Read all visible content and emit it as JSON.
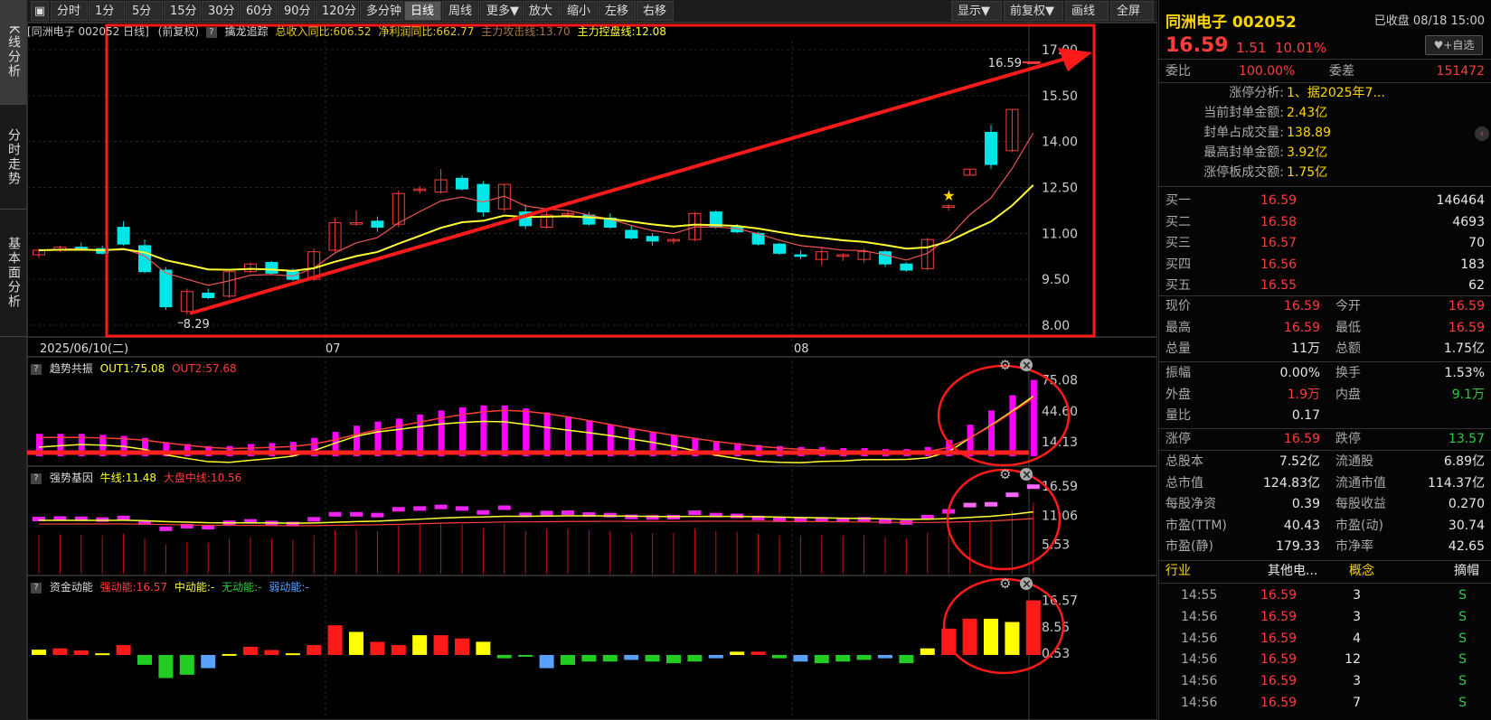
{
  "side_tabs": [
    "K线分析",
    "分时走势",
    "基本面分析"
  ],
  "toolbar": {
    "left": [
      "分时",
      "1分",
      "5分",
      "15分",
      "30分",
      "60分",
      "90分",
      "120分",
      "多分钟",
      "日线",
      "周线",
      "更多▼",
      "放大",
      "缩小",
      "左移",
      "右移"
    ],
    "right": [
      "显示▼",
      "前复权▼",
      "画线",
      "全屏"
    ],
    "active": "日线"
  },
  "main_panel": {
    "title": "[同洲电子 002052 日线]",
    "adjust": "(前复权)",
    "indicator_name": "擒龙追踪",
    "metrics": [
      {
        "text": "总收入同比:606.52",
        "color": "#e6c82e"
      },
      {
        "text": "净利润同比:662.77",
        "color": "#e6c82e"
      },
      {
        "text": "主力攻击线:13.70",
        "color": "#ee5555"
      },
      {
        "text": "主力控盘线:12.08",
        "color": "#ffff33"
      }
    ],
    "y_ticks": [
      "17.00",
      "15.50",
      "14.00",
      "12.50",
      "11.00",
      "9.50",
      "8.00"
    ],
    "last_price_label": "16.59",
    "low_label": "8.29",
    "date_labels": [
      "2025/06/10(二)",
      "07",
      "08"
    ]
  },
  "panel2": {
    "name": "趋势共振",
    "metrics": [
      {
        "text": "OUT1:75.08",
        "color": "#ffff33"
      },
      {
        "text": "OUT2:57.68",
        "color": "#ff3c3c"
      }
    ],
    "y_ticks": [
      "75.08",
      "44.60",
      "14.13"
    ]
  },
  "panel3": {
    "name": "强势基因",
    "metrics": [
      {
        "text": "牛线:11.48",
        "color": "#ffff33"
      },
      {
        "text": "大盘中线:10.56",
        "color": "#ff3c3c"
      }
    ],
    "y_ticks": [
      "16.59",
      "11.06",
      "5.53"
    ]
  },
  "panel4": {
    "name": "资金动能",
    "metrics": [
      {
        "text": "强动能:16.57",
        "color": "#ff3c3c"
      },
      {
        "text": "中动能:-",
        "color": "#ffff33"
      },
      {
        "text": "无动能:-",
        "color": "#2ecc40"
      },
      {
        "text": "弱动能:-",
        "color": "#5aa0ff"
      }
    ],
    "y_ticks": [
      "16.57",
      "8.55",
      "0.53"
    ]
  },
  "chart_data": [
    {
      "type": "candlestick",
      "title": "同洲电子 002052 日线",
      "ylim": [
        8.0,
        17.0
      ],
      "candles": [
        [
          10.3,
          10.5,
          10.2,
          10.45
        ],
        [
          10.45,
          10.6,
          10.4,
          10.55
        ],
        [
          10.55,
          10.7,
          10.45,
          10.5
        ],
        [
          10.5,
          10.6,
          10.3,
          10.35
        ],
        [
          11.2,
          11.4,
          10.6,
          10.65
        ],
        [
          10.6,
          10.8,
          9.7,
          9.75
        ],
        [
          9.8,
          9.9,
          8.5,
          8.6
        ],
        [
          8.45,
          9.2,
          8.35,
          9.1
        ],
        [
          9.05,
          9.2,
          8.85,
          8.9
        ],
        [
          8.95,
          9.8,
          8.9,
          9.75
        ],
        [
          9.75,
          10.05,
          9.7,
          10.0
        ],
        [
          10.05,
          10.1,
          9.65,
          9.7
        ],
        [
          9.75,
          9.85,
          9.45,
          9.5
        ],
        [
          9.5,
          10.5,
          9.45,
          10.4
        ],
        [
          10.45,
          11.5,
          10.4,
          11.35
        ],
        [
          11.3,
          11.75,
          11.25,
          11.35
        ],
        [
          11.4,
          11.55,
          11.05,
          11.2
        ],
        [
          11.3,
          12.4,
          11.2,
          12.3
        ],
        [
          12.4,
          12.55,
          12.3,
          12.45
        ],
        [
          12.35,
          13.1,
          12.3,
          12.75
        ],
        [
          12.8,
          12.9,
          12.4,
          12.45
        ],
        [
          12.6,
          12.7,
          11.55,
          11.7
        ],
        [
          11.8,
          12.6,
          11.7,
          12.6
        ],
        [
          11.7,
          11.95,
          11.15,
          11.25
        ],
        [
          11.2,
          11.7,
          11.15,
          11.6
        ],
        [
          11.6,
          11.75,
          11.5,
          11.65
        ],
        [
          11.6,
          11.7,
          11.25,
          11.3
        ],
        [
          11.5,
          11.65,
          11.15,
          11.2
        ],
        [
          11.1,
          11.25,
          10.8,
          10.85
        ],
        [
          10.9,
          11.0,
          10.6,
          10.75
        ],
        [
          10.75,
          10.85,
          10.65,
          10.8
        ],
        [
          10.8,
          11.7,
          10.75,
          11.65
        ],
        [
          11.7,
          11.75,
          11.15,
          11.2
        ],
        [
          11.2,
          11.3,
          11.0,
          11.05
        ],
        [
          11.0,
          11.05,
          10.6,
          10.65
        ],
        [
          10.65,
          10.7,
          10.3,
          10.35
        ],
        [
          10.3,
          10.45,
          10.15,
          10.25
        ],
        [
          10.15,
          10.55,
          9.95,
          10.4
        ],
        [
          10.25,
          10.35,
          10.1,
          10.3
        ],
        [
          10.15,
          10.5,
          10.05,
          10.4
        ],
        [
          10.4,
          10.45,
          9.9,
          10.0
        ],
        [
          10.0,
          10.05,
          9.75,
          9.8
        ],
        [
          9.85,
          10.85,
          9.8,
          10.8
        ],
        [
          11.85,
          11.95,
          11.75,
          11.9
        ],
        [
          12.9,
          13.1,
          12.9,
          13.1
        ],
        [
          14.3,
          14.55,
          13.1,
          13.25
        ],
        [
          13.7,
          15.05,
          13.65,
          15.05
        ],
        [
          16.59,
          16.59,
          16.59,
          16.59
        ]
      ],
      "series": [
        {
          "name": "主力攻击线",
          "color": "#ee5555"
        },
        {
          "name": "主力控盘线",
          "color": "#ffff33"
        }
      ]
    },
    {
      "type": "bar",
      "title": "趋势共振",
      "series": [
        {
          "name": "OUT1",
          "color": "#ffff33"
        },
        {
          "name": "OUT2",
          "color": "#ff3c3c"
        }
      ],
      "values": [
        22,
        22,
        22,
        21,
        20,
        18,
        14,
        12,
        10,
        10,
        12,
        13,
        14,
        18,
        24,
        30,
        34,
        37,
        41,
        45,
        48,
        50,
        50,
        47,
        43,
        39,
        35,
        31,
        27,
        24,
        21,
        18,
        15,
        13,
        11,
        10,
        9,
        9,
        8,
        8,
        7,
        7,
        9,
        16,
        31,
        45,
        60,
        75.08
      ]
    },
    {
      "type": "bar",
      "title": "强势基因",
      "ylim": [
        0,
        16.59
      ]
    },
    {
      "type": "bar",
      "title": "资金动能",
      "values": [
        1.6,
        2,
        1.4,
        0.5,
        3,
        -3,
        -7,
        -6,
        -4,
        0.3,
        2.5,
        1.5,
        0.5,
        3,
        9,
        7,
        4,
        3,
        6,
        6,
        5,
        4,
        -1,
        -0.5,
        -4,
        -3,
        -2,
        -2,
        -1.5,
        -2,
        -2.5,
        -2,
        -1,
        1,
        1,
        -1,
        -2,
        -2.5,
        -2,
        -1.5,
        -1,
        -2.5,
        2,
        8,
        11,
        11,
        10,
        16.57
      ]
    }
  ],
  "right_panel": {
    "stock_name": "同洲电子 002052",
    "status": "已收盘 08/18 15:00",
    "price": "16.59",
    "change": "1.51",
    "change_pct": "10.01%",
    "fav_button": "♥+自选",
    "weibi_label": "委比",
    "weibi": "100.00%",
    "weicha_label": "委差",
    "weicha": "151472",
    "limit_info": [
      {
        "label": "涨停分析:",
        "value": "1、据2025年7..."
      },
      {
        "label": "当前封单金额:",
        "value": "2.43亿"
      },
      {
        "label": "封单占成交量:",
        "value": "138.89"
      },
      {
        "label": "最高封单金额:",
        "value": "3.92亿"
      },
      {
        "label": "涨停板成交额:",
        "value": "1.75亿"
      }
    ],
    "bids": [
      {
        "label": "买一",
        "price": "16.59",
        "vol": "146464"
      },
      {
        "label": "买二",
        "price": "16.58",
        "vol": "4693"
      },
      {
        "label": "买三",
        "price": "16.57",
        "vol": "70"
      },
      {
        "label": "买四",
        "price": "16.56",
        "vol": "183"
      },
      {
        "label": "买五",
        "price": "16.55",
        "vol": "62"
      }
    ],
    "stats_a": [
      {
        "l1": "现价",
        "v1": "16.59",
        "c1": "red",
        "l2": "今开",
        "v2": "16.59",
        "c2": "red"
      },
      {
        "l1": "最高",
        "v1": "16.59",
        "c1": "red",
        "l2": "最低",
        "v2": "16.59",
        "c2": "red"
      },
      {
        "l1": "总量",
        "v1": "11万",
        "c1": "white",
        "l2": "总额",
        "v2": "1.75亿",
        "c2": "white"
      }
    ],
    "stats_b": [
      {
        "l1": "振幅",
        "v1": "0.00%",
        "c1": "white",
        "l2": "换手",
        "v2": "1.53%",
        "c2": "white"
      },
      {
        "l1": "外盘",
        "v1": "1.9万",
        "c1": "red",
        "l2": "内盘",
        "v2": "9.1万",
        "c2": "green"
      },
      {
        "l1": "量比",
        "v1": "0.17",
        "c1": "white",
        "l2": "",
        "v2": "",
        "c2": "white"
      }
    ],
    "stats_c": [
      {
        "l1": "涨停",
        "v1": "16.59",
        "c1": "red",
        "l2": "跌停",
        "v2": "13.57",
        "c2": "green"
      }
    ],
    "stats_d": [
      {
        "l1": "总股本",
        "v1": "7.52亿",
        "c1": "white",
        "l2": "流通股",
        "v2": "6.89亿",
        "c2": "white"
      },
      {
        "l1": "总市值",
        "v1": "124.83亿",
        "c1": "white",
        "l2": "流通市值",
        "v2": "114.37亿",
        "c2": "white"
      },
      {
        "l1": "每股净资",
        "v1": "0.39",
        "c1": "white",
        "l2": "每股收益",
        "v2": "0.270",
        "c2": "white"
      },
      {
        "l1": "市盈(TTM)",
        "v1": "40.43",
        "c1": "white",
        "l2": "市盈(动)",
        "v2": "30.74",
        "c2": "white"
      },
      {
        "l1": "市盈(静)",
        "v1": "179.33",
        "c1": "white",
        "l2": "市净率",
        "v2": "42.65",
        "c2": "white"
      }
    ],
    "industry": {
      "label": "行业",
      "value": "其他电...",
      "concept": "概念",
      "summary": "摘帽"
    },
    "ticks": [
      {
        "time": "14:55",
        "price": "16.59",
        "vol": "3",
        "side": "S"
      },
      {
        "time": "14:56",
        "price": "16.59",
        "vol": "3",
        "side": "S"
      },
      {
        "time": "14:56",
        "price": "16.59",
        "vol": "4",
        "side": "S"
      },
      {
        "time": "14:56",
        "price": "16.59",
        "vol": "12",
        "side": "S"
      },
      {
        "time": "14:56",
        "price": "16.59",
        "vol": "3",
        "side": "S"
      },
      {
        "time": "14:56",
        "price": "16.59",
        "vol": "7",
        "side": "S"
      }
    ],
    "colors": {
      "up": "#ff3c3c",
      "down": "#2ecc40",
      "label": "#ffd700"
    }
  }
}
